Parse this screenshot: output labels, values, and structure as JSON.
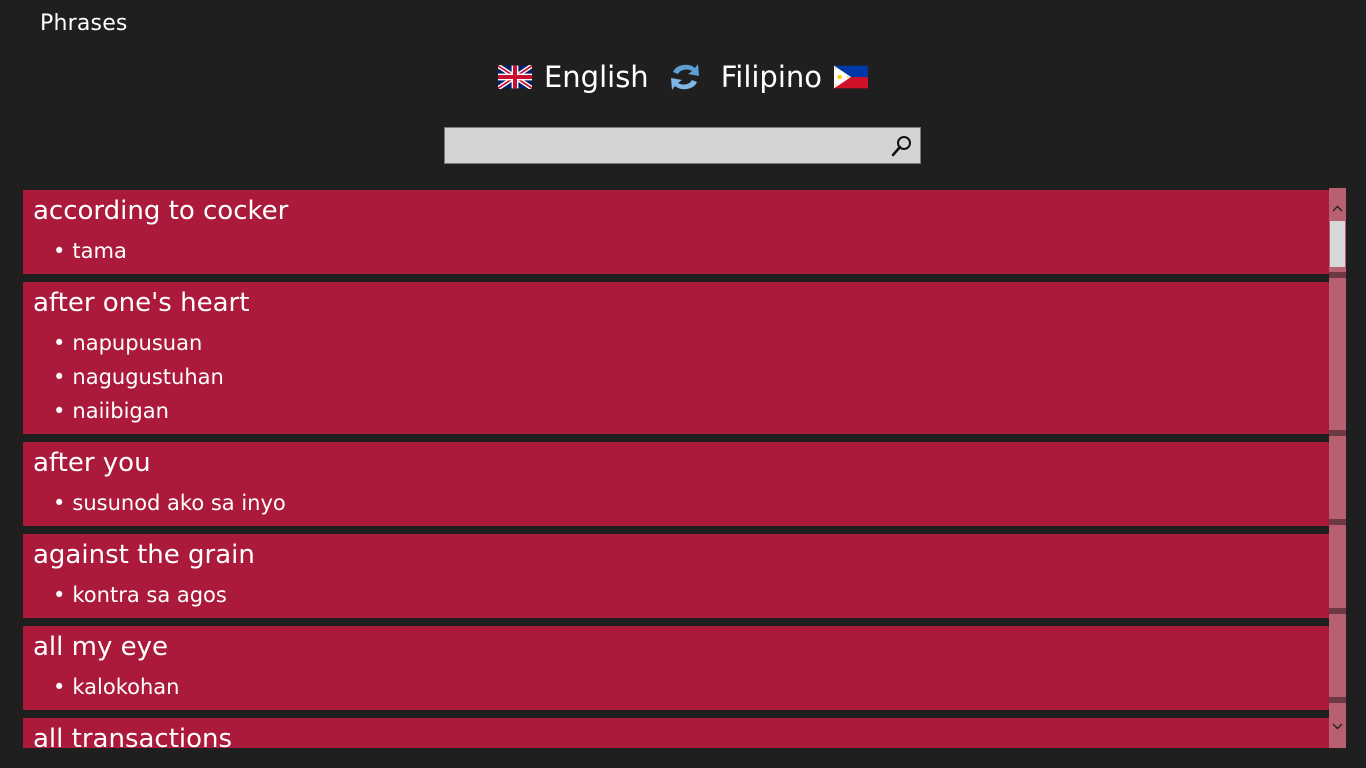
{
  "app": {
    "title": "Phrases"
  },
  "languages": {
    "source": {
      "label": "English",
      "flag_icon": "uk-flag-icon"
    },
    "target": {
      "label": "Filipino",
      "flag_icon": "philippines-flag-icon"
    },
    "swap_icon": "swap-arrows-icon"
  },
  "search": {
    "value": "",
    "placeholder": "",
    "icon": "magnifier-icon"
  },
  "entries": [
    {
      "phrase": "according to cocker",
      "translations": [
        "tama"
      ]
    },
    {
      "phrase": "after one's heart",
      "translations": [
        "napupusuan",
        "nagugustuhan",
        "naiibigan"
      ]
    },
    {
      "phrase": "after you",
      "translations": [
        "susunod ako sa inyo"
      ]
    },
    {
      "phrase": "against the grain",
      "translations": [
        "kontra sa agos"
      ]
    },
    {
      "phrase": "all my eye",
      "translations": [
        "kalokohan"
      ]
    },
    {
      "phrase": "all transactions",
      "translations": []
    }
  ],
  "colors": {
    "background": "#1f1f1f",
    "entry": "#ab1a3b",
    "scrollbar": "#b8606f",
    "search_box": "#d4d4d4"
  }
}
